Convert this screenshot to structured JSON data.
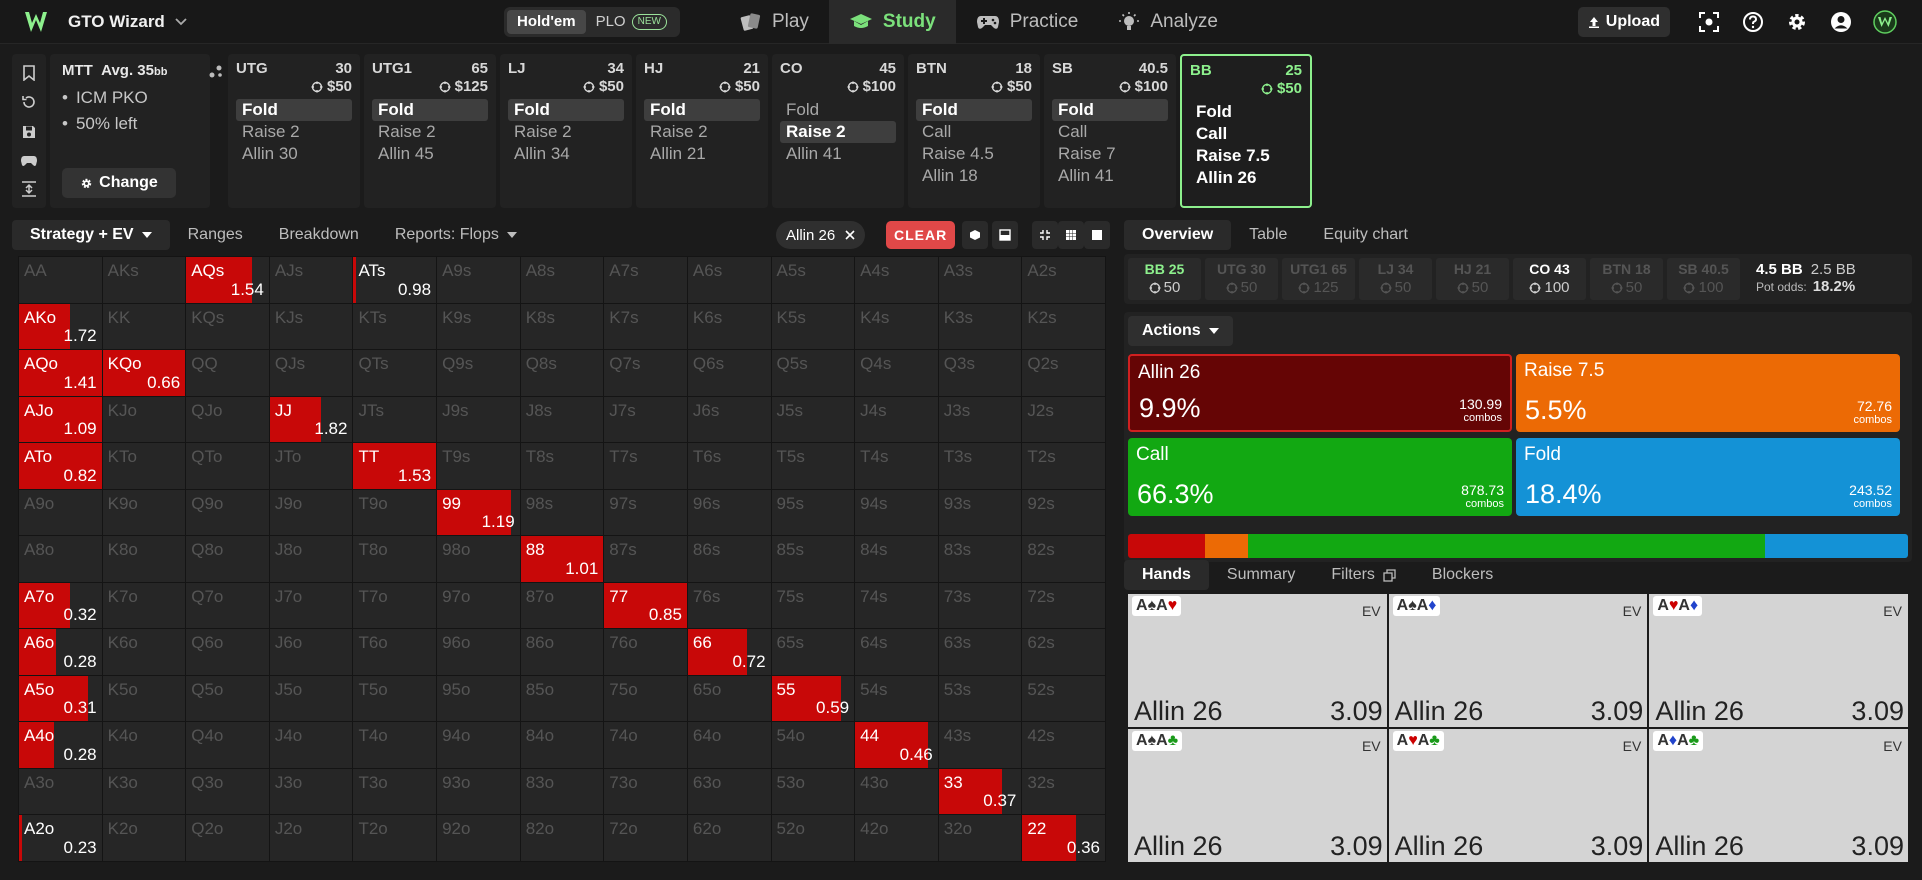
{
  "topbar": {
    "brand": "GTO Wizard",
    "game_options": [
      {
        "label": "Hold'em",
        "active": true
      },
      {
        "label": "PLO",
        "badge": "NEW"
      }
    ],
    "nav": [
      {
        "label": "Play",
        "icon": "cards-icon"
      },
      {
        "label": "Study",
        "icon": "graduation-cap-icon",
        "active": true
      },
      {
        "label": "Practice",
        "icon": "gamepad-icon"
      },
      {
        "label": "Analyze",
        "icon": "lightbulb-icon"
      }
    ],
    "upload": "Upload"
  },
  "mtt": {
    "title": "MTT",
    "avg": "Avg. 35",
    "avg_unit": "bb",
    "bullets": [
      "ICM PKO",
      "50% left"
    ],
    "change": "Change"
  },
  "positions": [
    {
      "name": "UTG",
      "stack": "30",
      "bounty": "$50",
      "actions": [
        "Fold",
        "Raise 2",
        "Allin 30"
      ],
      "selected": 0
    },
    {
      "name": "UTG1",
      "stack": "65",
      "bounty": "$125",
      "actions": [
        "Fold",
        "Raise 2",
        "Allin 45"
      ],
      "selected": 0
    },
    {
      "name": "LJ",
      "stack": "34",
      "bounty": "$50",
      "actions": [
        "Fold",
        "Raise 2",
        "Allin 34"
      ],
      "selected": 0
    },
    {
      "name": "HJ",
      "stack": "21",
      "bounty": "$50",
      "actions": [
        "Fold",
        "Raise 2",
        "Allin 21"
      ],
      "selected": 0
    },
    {
      "name": "CO",
      "stack": "45",
      "bounty": "$100",
      "actions": [
        "Fold",
        "Raise 2",
        "Allin 41"
      ],
      "selected": 1
    },
    {
      "name": "BTN",
      "stack": "18",
      "bounty": "$50",
      "actions": [
        "Fold",
        "Call",
        "Raise 4.5",
        "Allin 18"
      ],
      "selected": 0
    },
    {
      "name": "SB",
      "stack": "40.5",
      "bounty": "$100",
      "actions": [
        "Fold",
        "Call",
        "Raise 7",
        "Allin 41"
      ],
      "selected": 0
    },
    {
      "name": "BB",
      "stack": "25",
      "bounty": "$50",
      "actions": [
        "Fold",
        "Call",
        "Raise 7.5",
        "Allin 26"
      ],
      "selected": -1,
      "active": true
    }
  ],
  "lefttabs": {
    "strategy": "Strategy + EV",
    "ranges": "Ranges",
    "breakdown": "Breakdown",
    "reports": "Reports: Flops",
    "chip": "Allin 26",
    "clear": "CLEAR"
  },
  "grid": {
    "ranks": [
      "A",
      "K",
      "Q",
      "J",
      "T",
      "9",
      "8",
      "7",
      "6",
      "5",
      "4",
      "3",
      "2"
    ],
    "highlight": [
      {
        "r": 0,
        "c": 2,
        "fill": 0.8,
        "ev": "1.54"
      },
      {
        "r": 0,
        "c": 4,
        "fill": 0.03,
        "ev": "0.98"
      },
      {
        "r": 1,
        "c": 0,
        "fill": 0.62,
        "ev": "1.72"
      },
      {
        "r": 2,
        "c": 0,
        "fill": 1,
        "ev": "1.41"
      },
      {
        "r": 2,
        "c": 1,
        "fill": 1,
        "ev": "0.66"
      },
      {
        "r": 3,
        "c": 0,
        "fill": 1,
        "ev": "1.09"
      },
      {
        "r": 3,
        "c": 3,
        "fill": 0.62,
        "ev": "1.82"
      },
      {
        "r": 4,
        "c": 0,
        "fill": 1,
        "ev": "0.82"
      },
      {
        "r": 4,
        "c": 4,
        "fill": 1,
        "ev": "1.53"
      },
      {
        "r": 5,
        "c": 5,
        "fill": 0.9,
        "ev": "1.19"
      },
      {
        "r": 6,
        "c": 6,
        "fill": 1,
        "ev": "1.01"
      },
      {
        "r": 7,
        "c": 0,
        "fill": 0.62,
        "ev": "0.32"
      },
      {
        "r": 7,
        "c": 7,
        "fill": 1,
        "ev": "0.85"
      },
      {
        "r": 8,
        "c": 0,
        "fill": 0.45,
        "ev": "0.28"
      },
      {
        "r": 8,
        "c": 8,
        "fill": 0.72,
        "ev": "0.72"
      },
      {
        "r": 9,
        "c": 0,
        "fill": 0.84,
        "ev": "0.31"
      },
      {
        "r": 9,
        "c": 9,
        "fill": 0.84,
        "ev": "0.59"
      },
      {
        "r": 10,
        "c": 0,
        "fill": 0.42,
        "ev": "0.28"
      },
      {
        "r": 10,
        "c": 10,
        "fill": 0.88,
        "ev": "0.46"
      },
      {
        "r": 11,
        "c": 11,
        "fill": 0.77,
        "ev": "0.37"
      },
      {
        "r": 12,
        "c": 0,
        "fill": 0.04,
        "ev": "0.23"
      },
      {
        "r": 12,
        "c": 12,
        "fill": 0.65,
        "ev": "0.36"
      }
    ]
  },
  "righttabs": [
    "Overview",
    "Table",
    "Equity chart"
  ],
  "seats": [
    {
      "name": "BB 25",
      "val": "50",
      "hero": true
    },
    {
      "name": "UTG 30",
      "val": "50"
    },
    {
      "name": "UTG1 65",
      "val": "125"
    },
    {
      "name": "LJ 34",
      "val": "50"
    },
    {
      "name": "HJ 21",
      "val": "50"
    },
    {
      "name": "CO 43",
      "val": "100",
      "lit": true
    },
    {
      "name": "BTN 18",
      "val": "50"
    },
    {
      "name": "SB 40.5",
      "val": "100"
    }
  ],
  "pot": {
    "total": "4.5 BB",
    "call": "2.5 BB",
    "odds_label": "Pot odds:",
    "odds": "18.2%"
  },
  "actions_label": "Actions",
  "action_boxes": [
    {
      "name": "Allin 26",
      "pct": "9.9%",
      "combos": "130.99",
      "combos_label": "combos",
      "color": "#650505",
      "border": "#d02020"
    },
    {
      "name": "Raise 7.5",
      "pct": "5.5%",
      "combos": "72.76",
      "combos_label": "combos",
      "color": "#ec6a05"
    },
    {
      "name": "Call",
      "pct": "66.3%",
      "combos": "878.73",
      "combos_label": "combos",
      "color": "#12a812"
    },
    {
      "name": "Fold",
      "pct": "18.4%",
      "combos": "243.52",
      "combos_label": "combos",
      "color": "#1492d6"
    }
  ],
  "freqbar": [
    {
      "pct": 9.9,
      "color": "#c80808"
    },
    {
      "pct": 5.5,
      "color": "#ec6a05"
    },
    {
      "pct": 66.3,
      "color": "#12a812"
    },
    {
      "pct": 18.3,
      "color": "#1492d6"
    }
  ],
  "handtabs": [
    "Hands",
    "Summary",
    "Filters",
    "Blockers"
  ],
  "hands": [
    {
      "c1": "A",
      "s1": "♠",
      "k1": "s-k",
      "c2": "A",
      "s2": "♥",
      "k2": "s-r",
      "ev_label": "EV",
      "action": "Allin 26",
      "value": "3.09"
    },
    {
      "c1": "A",
      "s1": "♠",
      "k1": "s-k",
      "c2": "A",
      "s2": "♦",
      "k2": "s-b",
      "ev_label": "EV",
      "action": "Allin 26",
      "value": "3.09"
    },
    {
      "c1": "A",
      "s1": "♥",
      "k1": "s-r",
      "c2": "A",
      "s2": "♦",
      "k2": "s-b",
      "ev_label": "EV",
      "action": "Allin 26",
      "value": "3.09"
    },
    {
      "c1": "A",
      "s1": "♠",
      "k1": "s-k",
      "c2": "A",
      "s2": "♣",
      "k2": "s-g",
      "ev_label": "EV",
      "action": "Allin 26",
      "value": "3.09"
    },
    {
      "c1": "A",
      "s1": "♥",
      "k1": "s-r",
      "c2": "A",
      "s2": "♣",
      "k2": "s-g",
      "ev_label": "EV",
      "action": "Allin 26",
      "value": "3.09"
    },
    {
      "c1": "A",
      "s1": "♦",
      "k1": "s-b",
      "c2": "A",
      "s2": "♣",
      "k2": "s-g",
      "ev_label": "EV",
      "action": "Allin 26",
      "value": "3.09"
    }
  ]
}
